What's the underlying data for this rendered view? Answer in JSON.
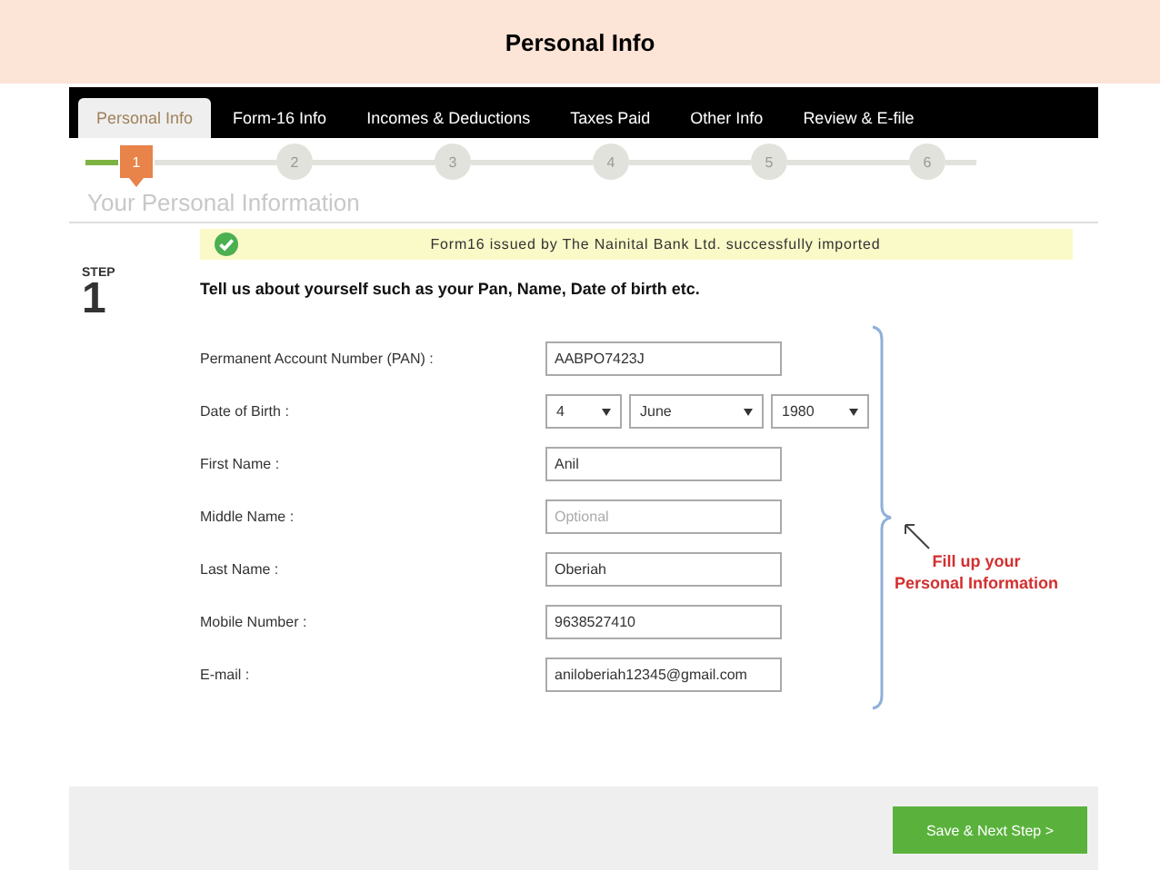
{
  "slide": {
    "title": "Personal Info"
  },
  "tabs": [
    {
      "label": "Personal Info",
      "selected": true
    },
    {
      "label": "Form-16 Info",
      "selected": false
    },
    {
      "label": "Incomes & Deductions",
      "selected": false
    },
    {
      "label": "Taxes Paid",
      "selected": false
    },
    {
      "label": "Other Info",
      "selected": false
    },
    {
      "label": "Review & E-file",
      "selected": false
    }
  ],
  "steps": [
    {
      "label": "1",
      "selected": true
    },
    {
      "label": "2",
      "selected": false
    },
    {
      "label": "3",
      "selected": false
    },
    {
      "label": "4",
      "selected": false
    },
    {
      "label": "5",
      "selected": false
    },
    {
      "label": "6",
      "selected": false
    }
  ],
  "heading": "Your Personal Information",
  "notice": "Form16 issued by The Nainital Bank Ltd. successfully imported",
  "step": {
    "label": "STEP",
    "number": "1"
  },
  "intro": "Tell us about yourself such as your Pan, Name, Date of birth etc.",
  "fields": [
    {
      "kind": "text",
      "label": "Permanent Account Number (PAN) :",
      "value": "AABPO7423J"
    },
    {
      "kind": "select",
      "label": "Date of Birth :",
      "values": [
        "4",
        "June",
        "1980"
      ]
    },
    {
      "kind": "text",
      "label": "First Name :",
      "value": "Anil"
    },
    {
      "kind": "text",
      "label": "Middle Name :",
      "placeholder": "Optional"
    },
    {
      "kind": "text",
      "label": "Last Name :",
      "value": "Oberiah"
    },
    {
      "kind": "text",
      "label": "Mobile Number :",
      "value": "9638527410"
    },
    {
      "kind": "text",
      "label": "E-mail :",
      "value": "aniloberiah12345@gmail.com"
    }
  ],
  "annotation": [
    "Fill up your",
    "Personal Information"
  ],
  "save_button": "Save & Next Step >"
}
